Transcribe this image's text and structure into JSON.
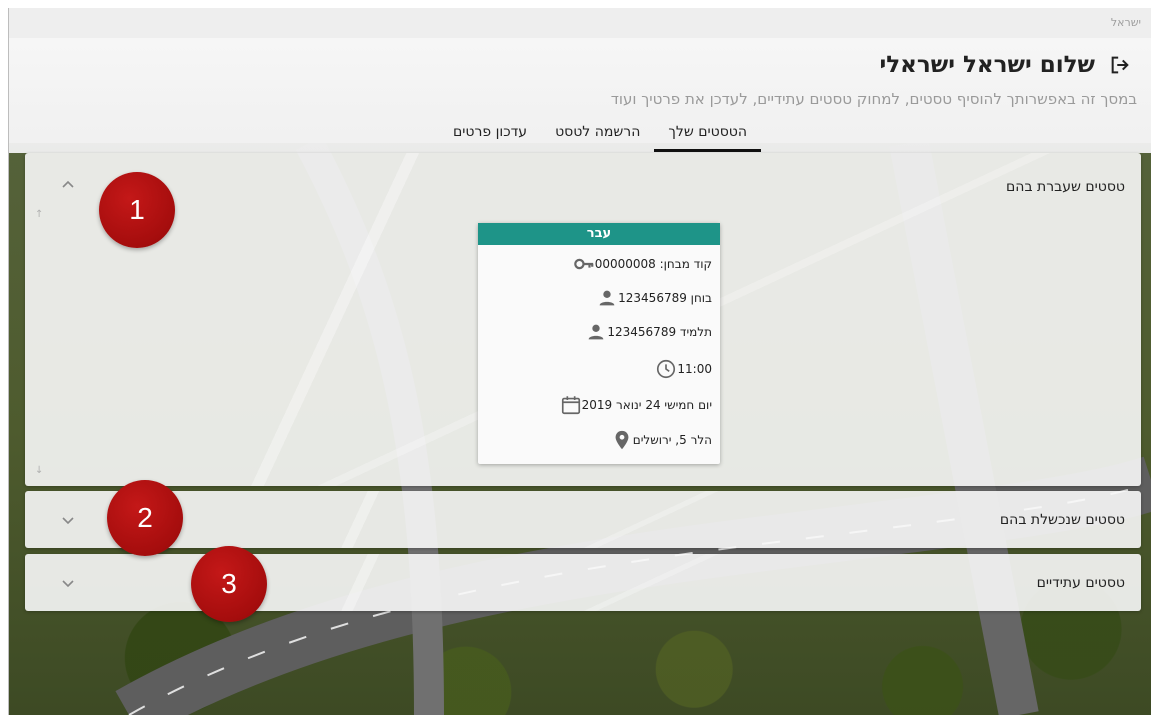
{
  "window": {
    "title": "ישראל"
  },
  "header": {
    "greeting": "שלום ישראל ישראלי",
    "subtitle": "במסך זה באפשרותך להוסיף טסטים, למחוק טסטים עתידיים, לעדכן את פרטיך ועוד",
    "tabs": [
      {
        "label": "הטסטים שלך",
        "active": true
      },
      {
        "label": "הרשמה לטסט",
        "active": false
      },
      {
        "label": "עדכון פרטים",
        "active": false
      }
    ]
  },
  "panels": [
    {
      "title": "טסטים שעברת בהם",
      "expanded": true
    },
    {
      "title": "טסטים שנכשלת בהם",
      "expanded": false
    },
    {
      "title": "טסטים עתידיים",
      "expanded": false
    }
  ],
  "card": {
    "status": "עבר",
    "status_color": "#1e9488",
    "rows": [
      {
        "icon": "key-icon",
        "text": "קוד מבחן: 00000008"
      },
      {
        "icon": "person-icon",
        "text": "בוחן 123456789"
      },
      {
        "icon": "person-icon",
        "text": "תלמיד 123456789"
      },
      {
        "icon": "clock-icon",
        "text": "11:00"
      },
      {
        "icon": "calendar-icon",
        "text": "יום חמישי 24 ינואר 2019"
      },
      {
        "icon": "location-pin-icon",
        "text": "הלר 5, ירושלים"
      }
    ]
  },
  "callouts": [
    "1",
    "2",
    "3"
  ],
  "colors": {
    "accent": "#1e9488",
    "callout": "#a50d0d"
  }
}
